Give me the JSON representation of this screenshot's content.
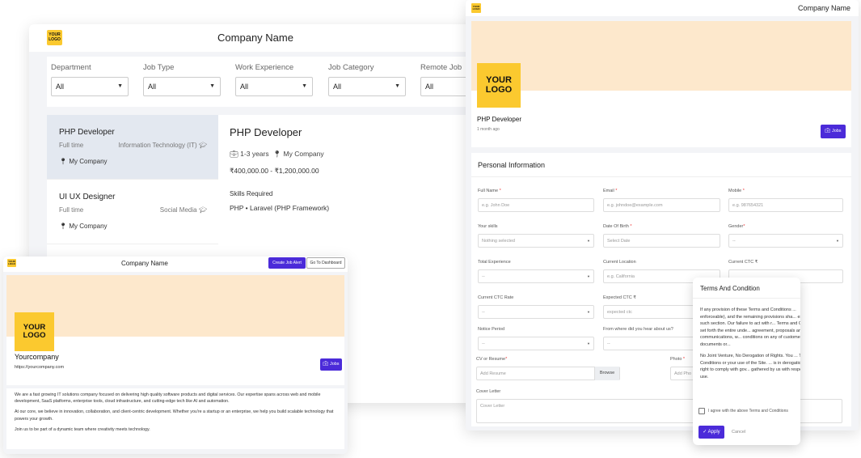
{
  "brand": {
    "logo_text": "YOUR LOGO",
    "accent": "#4b2bd9",
    "logo_bg": "#fbc92f",
    "banner_bg": "#fde8cc"
  },
  "listing": {
    "title": "Company Name",
    "filters": [
      {
        "label": "Department",
        "value": "All"
      },
      {
        "label": "Job Type",
        "value": "All"
      },
      {
        "label": "Work Experience",
        "value": "All"
      },
      {
        "label": "Job Category",
        "value": "All"
      },
      {
        "label": "Remote Job",
        "value": "All"
      }
    ],
    "jobs": [
      {
        "title": "PHP Developer",
        "type": "Full time",
        "category": "Information Technology (IT)",
        "location": "My Company"
      },
      {
        "title": "UI UX Designer",
        "type": "Full time",
        "category": "Social Media",
        "location": "My Company"
      }
    ],
    "detail": {
      "title": "PHP Developer",
      "experience": "1-3 years",
      "company": "My Company",
      "salary": "₹400,000.00 - ₹1,200,000.00",
      "skills_heading": "Skills Required",
      "skills": "PHP • Laravel (PHP Framework)"
    }
  },
  "profile": {
    "title": "Company Name",
    "create_alert": "Create Job Alert",
    "dashboard": "Go To Dashboard",
    "company_name": "Yourcompany",
    "url": "https://yourcompany.com",
    "jobs_button": "Jobs",
    "about": [
      "We are a fast growing IT solutions company focused on delivering high quality software products and digital services. Our expertise spans across web and mobile development, SaaS platforms, enterprise tools, cloud infrastructure, and cutting-edge tech like AI and automation.",
      "At our core, we believe in innovation, collaboration, and client-centric development. Whether you're a startup or an enterprise, we help you build scalable technology that powers your growth.",
      "Join us to be part of a dynamic team where creativity meets technology."
    ]
  },
  "application": {
    "title": "Company Name",
    "job_title": "PHP Developer",
    "posted": "1 month ago",
    "jobs_button": "Jobs",
    "section": "Personal Information",
    "fields": {
      "full_name": {
        "label": "Full Name",
        "placeholder": "e.g. John Doe"
      },
      "email": {
        "label": "Email",
        "placeholder": "e.g. johndoe@example.com"
      },
      "mobile": {
        "label": "Mobile",
        "placeholder": "e.g. 987654321"
      },
      "skills": {
        "label": "Your skills",
        "value": "Nothing selected"
      },
      "dob": {
        "label": "Date Of Birth",
        "placeholder": "Select Date"
      },
      "gender": {
        "label": "Gender",
        "value": "--"
      },
      "total_exp": {
        "label": "Total Experience",
        "value": "--"
      },
      "location": {
        "label": "Current Location",
        "placeholder": "e.g. California"
      },
      "current_ctc": {
        "label": "Current CTC ₹",
        "placeholder": ""
      },
      "ctc_rate": {
        "label": "Current CTC Rate",
        "value": "--"
      },
      "expected_ctc": {
        "label": "Expected CTC ₹",
        "placeholder": "expected ctc"
      },
      "notice": {
        "label": "Notice Period",
        "value": "--"
      },
      "heard": {
        "label": "From where did you hear about us?",
        "value": "--"
      },
      "cv": {
        "label": "CV or Resume",
        "placeholder": "Add Resume",
        "button": "Browse"
      },
      "photo": {
        "label": "Photo",
        "placeholder": "Add Pho"
      },
      "cover": {
        "label": "Cover Letter",
        "placeholder": "Cover Letter"
      }
    }
  },
  "terms": {
    "title": "Terms And Condition",
    "paragraphs": [
      "If any provision of these Terms and Conditions ... enforceable), and the remaining provisions sha... extent of such section. Our failure to act with r... Terms and Conditions set forth the entire unde... agreement, proposals and communications, w... conditions on any of customer's documents or...",
      "No Joint Venture, No Derogation of Rights. You ... Terms and Conditions or your use of the Site. ... is in derogation of our right to comply with gov... gathered by us with respect to such use."
    ],
    "agree": "I agree with the above Terms and Conditions",
    "apply": "Apply",
    "cancel": "Cancel"
  }
}
